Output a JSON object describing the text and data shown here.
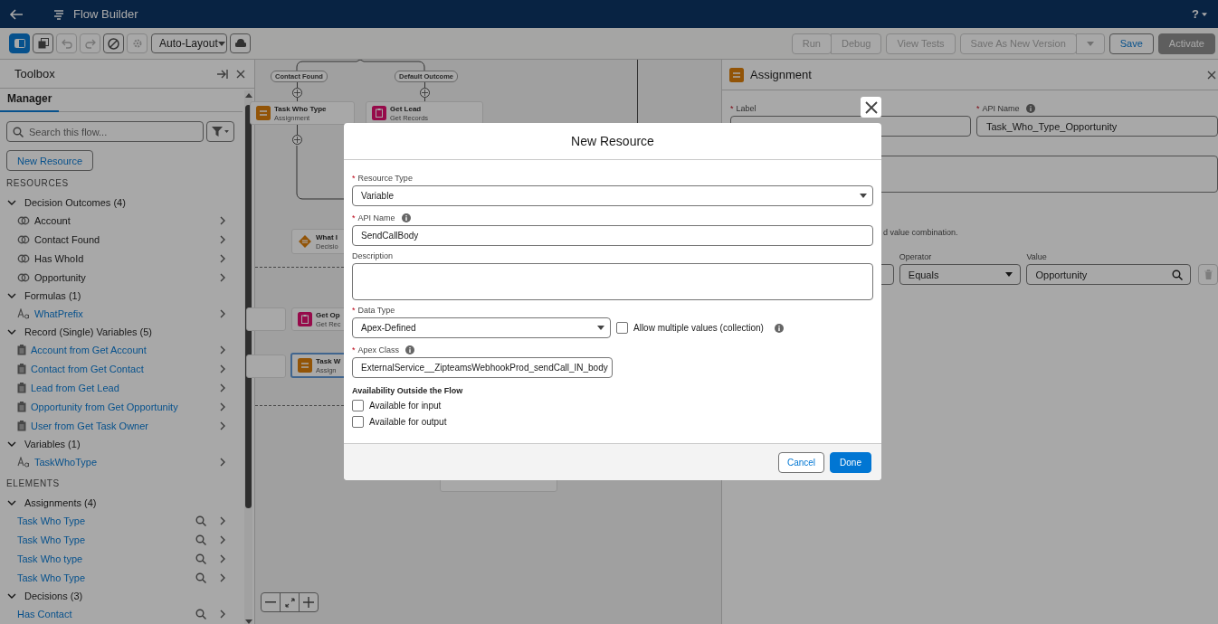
{
  "header": {
    "title": "Flow Builder",
    "help": "?"
  },
  "toolbar": {
    "tools": [
      {
        "kind": "panel",
        "selected": true,
        "disabled": false
      },
      {
        "kind": "copy",
        "selected": false,
        "disabled": false
      },
      {
        "kind": "undo",
        "selected": false,
        "disabled": true
      },
      {
        "kind": "redo",
        "selected": false,
        "disabled": true
      },
      {
        "kind": "block",
        "selected": false,
        "disabled": false
      },
      {
        "kind": "gear",
        "selected": false,
        "disabled": true
      }
    ],
    "layout_select": "Auto-Layout",
    "actions": [
      {
        "label": "Run",
        "kind": "neutral",
        "disabled": true,
        "joined": false
      },
      {
        "label": "Debug",
        "kind": "neutral",
        "disabled": true,
        "joined": true
      },
      {
        "label": "View Tests",
        "kind": "neutral",
        "disabled": true,
        "joined": false
      },
      {
        "label": "Save As New Version",
        "kind": "neutral",
        "disabled": true,
        "joined": false
      },
      {
        "kind": "menu",
        "disabled": true,
        "joined": true
      },
      {
        "label": "Save",
        "kind": "neutral",
        "disabled": false,
        "joined": false
      },
      {
        "label": "Activate",
        "kind": "brand",
        "disabled": true,
        "joined": false
      }
    ]
  },
  "toolbox": {
    "title": "Toolbox",
    "tabs": [
      {
        "label": "Manager",
        "selected": true
      }
    ],
    "search": {
      "placeholder": "Search this flow..."
    },
    "new_button": "New Resource",
    "sections": [
      {
        "heading": "RESOURCES",
        "groups": [
          {
            "label": "Decision Outcomes (4)",
            "expanded": true,
            "children": [
              {
                "label": "Account",
                "kind": "outcome"
              },
              {
                "label": "Contact Found",
                "kind": "outcome"
              },
              {
                "label": "Has WhoId",
                "kind": "outcome"
              },
              {
                "label": "Opportunity",
                "kind": "outcome"
              }
            ]
          },
          {
            "label": "Formulas (1)",
            "expanded": true,
            "children": [
              {
                "label": "WhatPrefix",
                "kind": "text"
              }
            ]
          },
          {
            "label": "Record (Single) Variables (5)",
            "expanded": true,
            "children": [
              {
                "label": "Account from Get Account",
                "kind": "record"
              },
              {
                "label": "Contact from Get Contact",
                "kind": "record"
              },
              {
                "label": "Lead from Get Lead",
                "kind": "record"
              },
              {
                "label": "Opportunity from Get Opportunity",
                "kind": "record"
              },
              {
                "label": "User from Get Task Owner",
                "kind": "record"
              }
            ]
          },
          {
            "label": "Variables (1)",
            "expanded": true,
            "children": [
              {
                "label": "TaskWhoType",
                "kind": "text"
              }
            ]
          }
        ]
      },
      {
        "heading": "ELEMENTS",
        "groups": [
          {
            "label": "Assignments (4)",
            "expanded": true,
            "children": [
              {
                "label": "Task Who Type",
                "kind": "element"
              },
              {
                "label": "Task Who Type",
                "kind": "element"
              },
              {
                "label": "Task Who type",
                "kind": "element"
              },
              {
                "label": "Task Who Type",
                "kind": "element"
              }
            ]
          },
          {
            "label": "Decisions (3)",
            "expanded": true,
            "children": [
              {
                "label": "Has Contact",
                "kind": "element"
              }
            ]
          }
        ]
      }
    ]
  },
  "canvas": {
    "outcome_labels": [
      "Contact Found",
      "Default Outcome"
    ],
    "nodes": [
      {
        "title": "Task Who Type",
        "subtitle": "Assignment",
        "kind": "assignment",
        "selected": false
      },
      {
        "title": "Get Lead",
        "subtitle": "Get Records",
        "kind": "records",
        "selected": false
      },
      {
        "title": "What I",
        "subtitle": "Decisio",
        "kind": "decision",
        "selected": false
      },
      {
        "title": "Get Op",
        "subtitle": "Get Rec",
        "kind": "records",
        "selected": false
      },
      {
        "title": "Task W",
        "subtitle": "Assign",
        "kind": "assignment",
        "selected": true
      }
    ]
  },
  "assignment_panel": {
    "title": "Assignment",
    "fields": [
      {
        "label": "Label",
        "required": true,
        "info": false
      },
      {
        "label": "API Name",
        "required": true,
        "info": true,
        "value": "Task_Who_Type_Opportunity"
      }
    ],
    "hint": "d value combination.",
    "operator_label": "Operator",
    "operator": "Equals",
    "value_label": "Value",
    "value": "Opportunity"
  },
  "modal": {
    "title": "New Resource",
    "required_mark": "*",
    "fields": [
      {
        "kind": "select",
        "label": "Resource Type",
        "required": true,
        "info": false,
        "value": "Variable"
      },
      {
        "kind": "text",
        "label": "API Name",
        "required": true,
        "info": true,
        "value": "SendCallBody"
      },
      {
        "kind": "textarea",
        "label": "Description",
        "required": false,
        "info": false
      },
      {
        "kind": "select-half",
        "label": "Data Type",
        "required": true,
        "info": false,
        "value": "Apex-Defined",
        "option": {
          "label": "Allow multiple values (collection)",
          "checked": false
        }
      },
      {
        "kind": "short-text",
        "label": "Apex Class",
        "required": true,
        "info": true,
        "value": "ExternalService__ZipteamsWebhookProd_sendCall_IN_body"
      }
    ],
    "availability": {
      "heading": "Availability Outside the Flow",
      "options": [
        {
          "label": "Available for input",
          "checked": false
        },
        {
          "label": "Available for output",
          "checked": false
        }
      ]
    },
    "buttons": [
      {
        "label": "Cancel",
        "kind": "neutral"
      },
      {
        "label": "Done",
        "kind": "brand"
      }
    ]
  }
}
